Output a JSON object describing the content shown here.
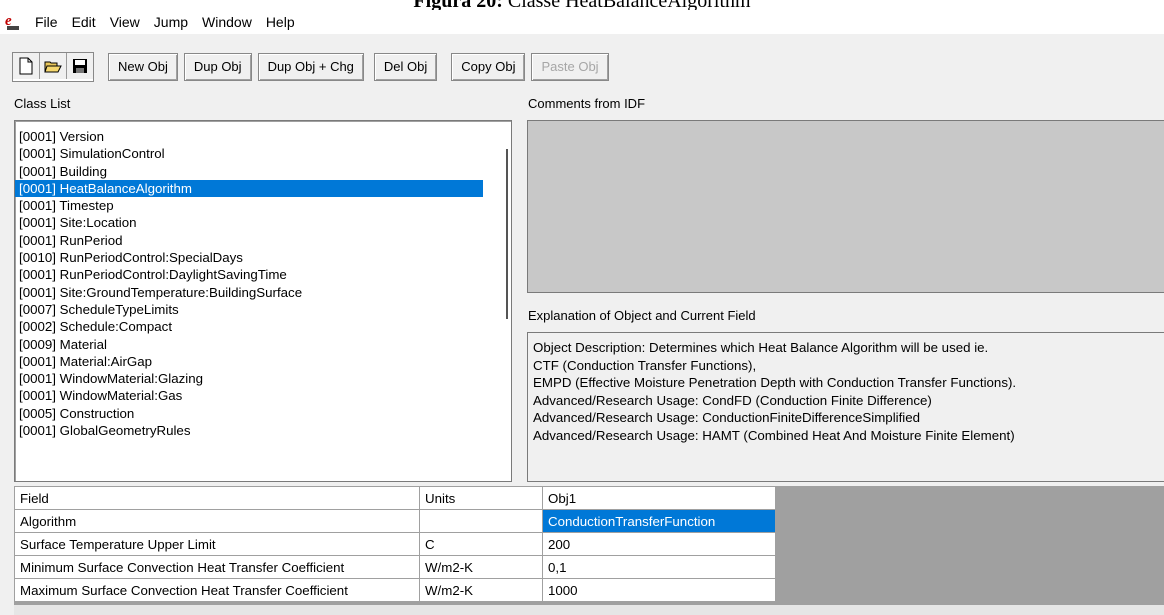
{
  "caption": {
    "prefix": "Figura 20:",
    "text": "Classe HeatBalanceAlgorithm"
  },
  "menu": [
    "File",
    "Edit",
    "View",
    "Jump",
    "Window",
    "Help"
  ],
  "toolbar": {
    "buttons": [
      "New Obj",
      "Dup Obj",
      "Dup Obj + Chg",
      "Del Obj",
      "Copy Obj",
      "Paste Obj"
    ]
  },
  "labels": {
    "class_list": "Class List",
    "comments": "Comments from IDF",
    "explanation": "Explanation of Object and Current Field"
  },
  "class_list": [
    "[0001]  Version",
    "[0001]  SimulationControl",
    "[0001]  Building",
    "[0001]  HeatBalanceAlgorithm",
    "[0001]  Timestep",
    "[0001]  Site:Location",
    "[0001]  RunPeriod",
    "[0010]  RunPeriodControl:SpecialDays",
    "[0001]  RunPeriodControl:DaylightSavingTime",
    "[0001]  Site:GroundTemperature:BuildingSurface",
    "[0007]  ScheduleTypeLimits",
    "[0002]  Schedule:Compact",
    "[0009]  Material",
    "[0001]  Material:AirGap",
    "[0001]  WindowMaterial:Glazing",
    "[0001]  WindowMaterial:Gas",
    "[0005]  Construction",
    "[0001]  GlobalGeometryRules"
  ],
  "selected_class_index": 3,
  "explanation_lines": [
    "Object Description: Determines which Heat Balance Algorithm will be used ie.",
    "CTF (Conduction Transfer Functions),",
    "EMPD (Effective Moisture Penetration Depth with Conduction Transfer Functions).",
    "Advanced/Research Usage: CondFD (Conduction Finite Difference)",
    "Advanced/Research Usage: ConductionFiniteDifferenceSimplified",
    "Advanced/Research Usage: HAMT (Combined Heat And Moisture Finite Element)"
  ],
  "grid": {
    "headers": [
      "Field",
      "Units",
      "Obj1"
    ],
    "rows": [
      {
        "field": "Algorithm",
        "units": "",
        "value": "ConductionTransferFunction"
      },
      {
        "field": "Surface Temperature Upper Limit",
        "units": "C",
        "value": "200"
      },
      {
        "field": "Minimum Surface Convection Heat Transfer Coefficient",
        "units": "W/m2-K",
        "value": "0,1"
      },
      {
        "field": "Maximum Surface Convection Heat Transfer Coefficient",
        "units": "W/m2-K",
        "value": "1000"
      }
    ]
  },
  "colors": {
    "selection": "#0078d7",
    "window_bg": "#f0f0f0",
    "comments_bg": "#c8c8c8"
  }
}
